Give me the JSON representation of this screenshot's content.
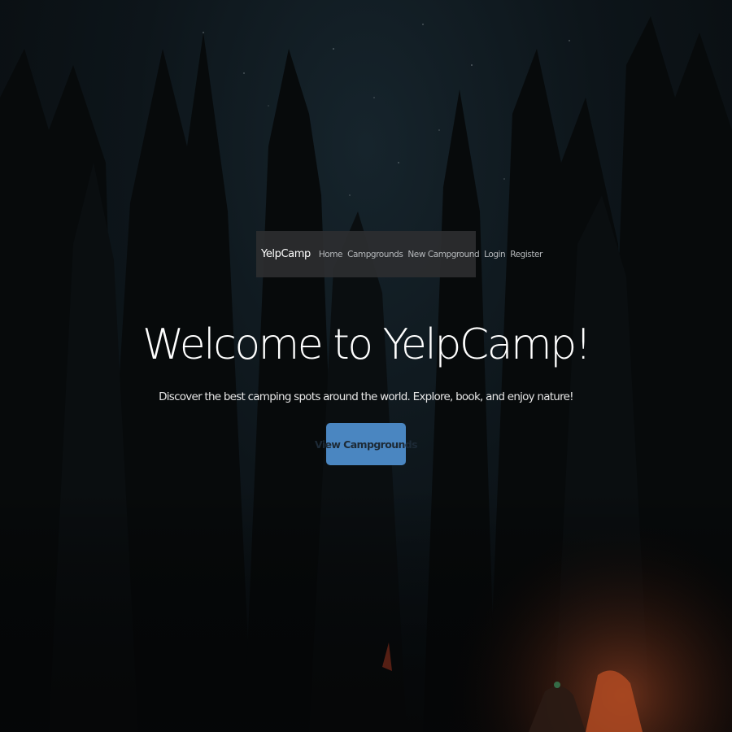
{
  "navbar": {
    "brand": "YelpCamp",
    "links": [
      {
        "label": "Home"
      },
      {
        "label": "Campgrounds"
      },
      {
        "label": "New Campground"
      },
      {
        "label": "Login"
      },
      {
        "label": "Register"
      }
    ]
  },
  "hero": {
    "title": "Welcome to YelpCamp!",
    "subtitle": "Discover the best camping spots around the world. Explore, book, and enjoy nature!",
    "cta_label": "View Campgrounds",
    "background": "night-forest-campsite-photo"
  },
  "colors": {
    "navbar_bg": "#2c2e30",
    "button_bg": "#4a86c1",
    "button_text": "#1d2a36",
    "title_text": "#ffffff",
    "nav_link": "#b5b8bb"
  }
}
